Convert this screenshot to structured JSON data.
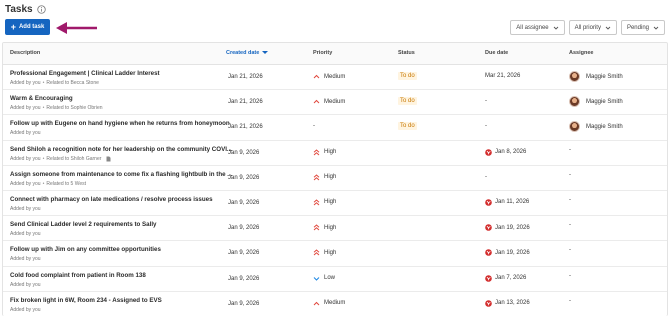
{
  "page": {
    "title": "Tasks",
    "add_button": "Add task"
  },
  "filters": [
    {
      "label": "All assignee"
    },
    {
      "label": "All priority"
    },
    {
      "label": "Pending"
    }
  ],
  "columns": {
    "description": "Description",
    "created_date": "Created date",
    "priority": "Priority",
    "status": "Status",
    "due_date": "Due date",
    "assignee": "Assignee"
  },
  "colors": {
    "accent": "#1565c0",
    "arrow": "#a0196b",
    "priority_high": "#e0483d",
    "priority_medium": "#e0483d",
    "priority_low": "#1e88e5",
    "status_bg": "#fff4e0",
    "status_text": "#c77700",
    "overdue": "#d32f2f"
  },
  "rows": [
    {
      "title": "Professional Engagement | Clinical Ladder Interest",
      "added": "Added by you",
      "related": "Related to Becca Stone",
      "doc": false,
      "created": "Jan 21, 2026",
      "priority": "Medium",
      "priority_icon": "chevron-up-icon",
      "status": "To do",
      "due": "Mar 21, 2026",
      "overdue": false,
      "assignee": "Maggie Smith"
    },
    {
      "title": "Warm & Encouraging",
      "added": "Added by you",
      "related": "Related to Sophie Obrien",
      "doc": false,
      "created": "Jan 21, 2026",
      "priority": "Medium",
      "priority_icon": "chevron-up-icon",
      "status": "To do",
      "due": "-",
      "overdue": false,
      "assignee": "Maggie Smith"
    },
    {
      "title": "Follow up with Eugene on hand hygiene when he returns from honeymoon",
      "added": "Added by you",
      "related": "",
      "doc": false,
      "created": "Jan 21, 2026",
      "priority": "-",
      "priority_icon": "",
      "status": "To do",
      "due": "-",
      "overdue": false,
      "assignee": "Maggie Smith"
    },
    {
      "title": "Send Shiloh a recognition note for her leadership on the community COVI...",
      "added": "Added by you",
      "related": "Related to Shiloh Garner",
      "doc": true,
      "created": "Jan 9, 2026",
      "priority": "High",
      "priority_icon": "double-chevron-up-icon",
      "status": "",
      "due": "Jan 8, 2026",
      "overdue": true,
      "assignee": "-"
    },
    {
      "title": "Assign someone from maintenance to come fix a flashing lightbulb in the ...",
      "added": "Added by you",
      "related": "Related to 5 West",
      "doc": false,
      "created": "Jan 9, 2026",
      "priority": "High",
      "priority_icon": "double-chevron-up-icon",
      "status": "",
      "due": "-",
      "overdue": false,
      "assignee": "-"
    },
    {
      "title": "Connect with pharmacy on late medications / resolve process issues",
      "added": "Added by you",
      "related": "",
      "doc": false,
      "created": "Jan 9, 2026",
      "priority": "High",
      "priority_icon": "double-chevron-up-icon",
      "status": "",
      "due": "Jan 11, 2026",
      "overdue": true,
      "assignee": "-"
    },
    {
      "title": "Send Clinical Ladder level 2 requirements to Sally",
      "added": "Added by you",
      "related": "",
      "doc": false,
      "created": "Jan 9, 2026",
      "priority": "High",
      "priority_icon": "double-chevron-up-icon",
      "status": "",
      "due": "Jan 19, 2026",
      "overdue": true,
      "assignee": "-"
    },
    {
      "title": "Follow up with Jim on any committee opportunities",
      "added": "Added by you",
      "related": "",
      "doc": false,
      "created": "Jan 9, 2026",
      "priority": "High",
      "priority_icon": "double-chevron-up-icon",
      "status": "",
      "due": "Jan 19, 2026",
      "overdue": true,
      "assignee": "-"
    },
    {
      "title": "Cold food complaint from patient in Room 138",
      "added": "Added by you",
      "related": "",
      "doc": false,
      "created": "Jan 9, 2026",
      "priority": "Low",
      "priority_icon": "chevron-down-icon",
      "status": "",
      "due": "Jan 7, 2026",
      "overdue": true,
      "assignee": "-"
    },
    {
      "title": "Fix broken light in 6W, Room 234 - Assigned to EVS",
      "added": "Added by you",
      "related": "",
      "doc": false,
      "created": "Jan 9, 2026",
      "priority": "Medium",
      "priority_icon": "chevron-up-icon",
      "status": "",
      "due": "Jan 13, 2026",
      "overdue": true,
      "assignee": "-"
    }
  ]
}
